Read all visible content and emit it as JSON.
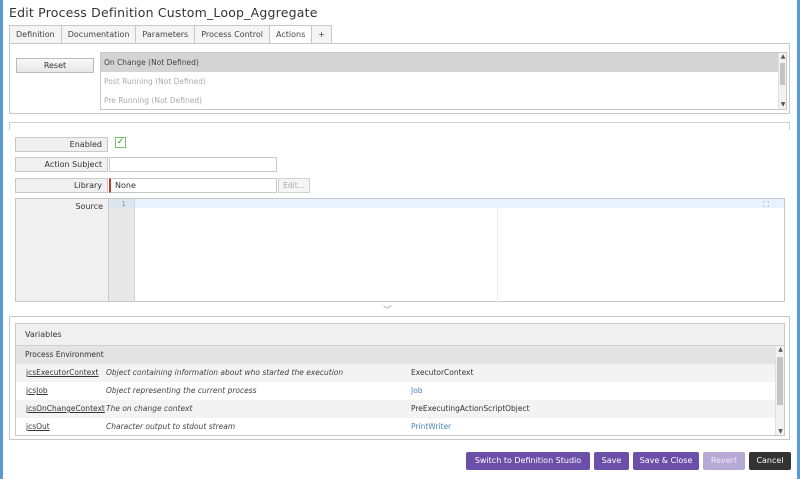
{
  "window": {
    "title": "Edit Process Definition Custom_Loop_Aggregate"
  },
  "tabs": [
    {
      "label": "Definition"
    },
    {
      "label": "Documentation"
    },
    {
      "label": "Parameters"
    },
    {
      "label": "Process Control"
    },
    {
      "label": "Actions",
      "active": true
    },
    {
      "label": "+"
    }
  ],
  "actions": {
    "reset_label": "Reset",
    "items": [
      "On Change (Not Defined)",
      "Post Running (Not Defined)",
      "Pre Running (Not Defined)"
    ],
    "selected_index": 0
  },
  "form": {
    "enabled_label": "Enabled",
    "enabled_checked": true,
    "action_subject_label": "Action Subject",
    "action_subject_value": "",
    "library_label": "Library",
    "library_value": "None",
    "edit_label": "Edit...",
    "source_label": "Source",
    "line_number": "1"
  },
  "variables": {
    "header": "Variables",
    "group": "Process Environment",
    "rows": [
      {
        "name": "jcsExecutorContext",
        "desc": "Object containing information about who started the execution",
        "type": "ExecutorContext",
        "type_link": false
      },
      {
        "name": "jcsJob",
        "desc": "Object representing the current process",
        "type": "Job",
        "type_link": true
      },
      {
        "name": "jcsOnChangeContext",
        "desc": "The on change context",
        "type": "PreExecutingActionScriptObject",
        "type_link": false
      },
      {
        "name": "jcsOut",
        "desc": "Character output to stdout stream",
        "type": "PrintWriter",
        "type_link": true
      }
    ]
  },
  "footer": {
    "switch_label": "Switch to Definition Studio",
    "save_label": "Save",
    "save_close_label": "Save & Close",
    "revert_label": "Revert",
    "cancel_label": "Cancel"
  },
  "colors": {
    "accent": "#5b9bd5",
    "button_primary": "#6c4fa8",
    "button_disabled": "#b6a9d6",
    "button_cancel": "#333333",
    "link": "#4a86c5",
    "required_marker": "#c0392b"
  }
}
